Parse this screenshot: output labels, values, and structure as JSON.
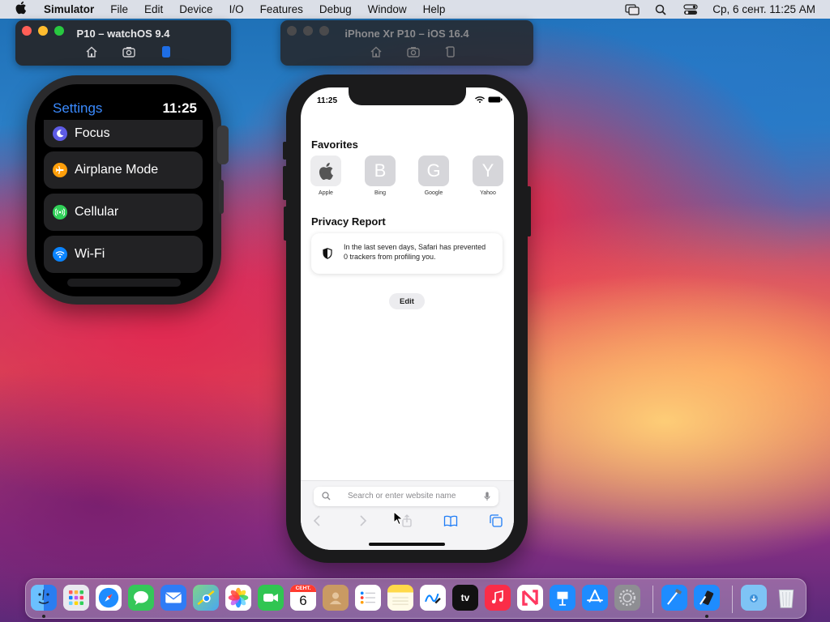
{
  "menubar": {
    "app_name": "Simulator",
    "items": [
      "File",
      "Edit",
      "Device",
      "I/O",
      "Features",
      "Debug",
      "Window",
      "Help"
    ],
    "clock": "Ср, 6 сент.  11:25 AM"
  },
  "watch_window": {
    "title": "P10 – watchOS 9.4"
  },
  "iphone_window": {
    "title": "iPhone Xr P10 – iOS 16.4"
  },
  "watch": {
    "title": "Settings",
    "time": "11:25",
    "items": [
      {
        "label": "Focus",
        "icon": "moon-icon",
        "color": "#5e5ce6"
      },
      {
        "label": "Airplane Mode",
        "icon": "airplane-icon",
        "color": "#ff9f0a"
      },
      {
        "label": "Cellular",
        "icon": "antenna-icon",
        "color": "#30d158"
      },
      {
        "label": "Wi-Fi",
        "icon": "wifi-icon",
        "color": "#0a84ff"
      }
    ]
  },
  "iphone": {
    "time": "11:25",
    "favorites_title": "Favorites",
    "favorites": [
      {
        "name": "Apple",
        "letter": ""
      },
      {
        "name": "Bing",
        "letter": "B"
      },
      {
        "name": "Google",
        "letter": "G"
      },
      {
        "name": "Yahoo",
        "letter": "Y"
      }
    ],
    "privacy_title": "Privacy Report",
    "privacy_text": "In the last seven days, Safari has prevented 0 trackers from profiling you.",
    "edit_label": "Edit",
    "search_placeholder": "Search or enter website name"
  },
  "dock": {
    "apps": [
      {
        "name": "Finder",
        "color": "#2d8cff"
      },
      {
        "name": "Launchpad",
        "color": "#e8e8ee"
      },
      {
        "name": "Safari",
        "color": "#1e8cff"
      },
      {
        "name": "Messages",
        "color": "#34c759"
      },
      {
        "name": "Mail",
        "color": "#2f7cf6"
      },
      {
        "name": "Maps",
        "color": "#5ac06b"
      },
      {
        "name": "Photos",
        "color": "#ffffff"
      },
      {
        "name": "FaceTime",
        "color": "#30c552"
      },
      {
        "name": "Calendar",
        "color": "#ffffff",
        "label_top": "СЕНТ.",
        "label_day": "6"
      },
      {
        "name": "Contacts",
        "color": "#c99a63"
      },
      {
        "name": "Reminders",
        "color": "#ffffff"
      },
      {
        "name": "Notes",
        "color": "#ffd94a"
      },
      {
        "name": "Freeform",
        "color": "#ffffff"
      },
      {
        "name": "TV",
        "color": "#111111",
        "label": "tv"
      },
      {
        "name": "Music",
        "color": "#fa2d48"
      },
      {
        "name": "News",
        "color": "#ffffff"
      },
      {
        "name": "Keynote",
        "color": "#1e8cff"
      },
      {
        "name": "App Store",
        "color": "#1e8cff"
      },
      {
        "name": "System Settings",
        "color": "#8e8e93"
      },
      {
        "name": "Xcode",
        "color": "#1e8cff"
      },
      {
        "name": "Simulator",
        "color": "#1e8cff"
      },
      {
        "name": "Downloads",
        "color": "#7ec3f5"
      },
      {
        "name": "Trash",
        "color": "#dfe3e8"
      }
    ]
  }
}
